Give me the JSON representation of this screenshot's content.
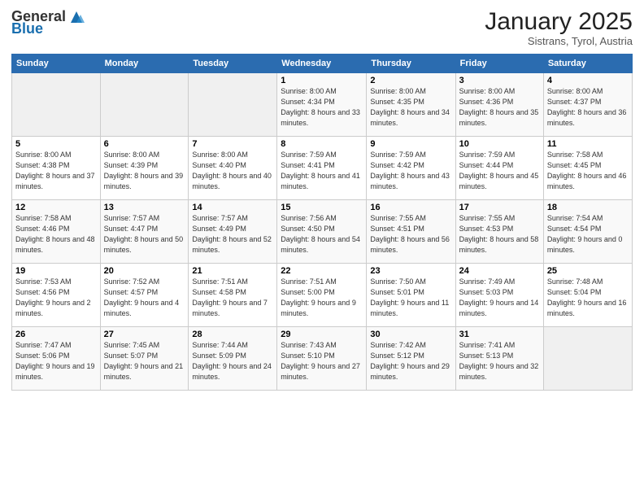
{
  "logo": {
    "general": "General",
    "blue": "Blue"
  },
  "header": {
    "month": "January 2025",
    "location": "Sistrans, Tyrol, Austria"
  },
  "days_of_week": [
    "Sunday",
    "Monday",
    "Tuesday",
    "Wednesday",
    "Thursday",
    "Friday",
    "Saturday"
  ],
  "weeks": [
    [
      {
        "day": "",
        "sunrise": "",
        "sunset": "",
        "daylight": ""
      },
      {
        "day": "",
        "sunrise": "",
        "sunset": "",
        "daylight": ""
      },
      {
        "day": "",
        "sunrise": "",
        "sunset": "",
        "daylight": ""
      },
      {
        "day": "1",
        "sunrise": "Sunrise: 8:00 AM",
        "sunset": "Sunset: 4:34 PM",
        "daylight": "Daylight: 8 hours and 33 minutes."
      },
      {
        "day": "2",
        "sunrise": "Sunrise: 8:00 AM",
        "sunset": "Sunset: 4:35 PM",
        "daylight": "Daylight: 8 hours and 34 minutes."
      },
      {
        "day": "3",
        "sunrise": "Sunrise: 8:00 AM",
        "sunset": "Sunset: 4:36 PM",
        "daylight": "Daylight: 8 hours and 35 minutes."
      },
      {
        "day": "4",
        "sunrise": "Sunrise: 8:00 AM",
        "sunset": "Sunset: 4:37 PM",
        "daylight": "Daylight: 8 hours and 36 minutes."
      }
    ],
    [
      {
        "day": "5",
        "sunrise": "Sunrise: 8:00 AM",
        "sunset": "Sunset: 4:38 PM",
        "daylight": "Daylight: 8 hours and 37 minutes."
      },
      {
        "day": "6",
        "sunrise": "Sunrise: 8:00 AM",
        "sunset": "Sunset: 4:39 PM",
        "daylight": "Daylight: 8 hours and 39 minutes."
      },
      {
        "day": "7",
        "sunrise": "Sunrise: 8:00 AM",
        "sunset": "Sunset: 4:40 PM",
        "daylight": "Daylight: 8 hours and 40 minutes."
      },
      {
        "day": "8",
        "sunrise": "Sunrise: 7:59 AM",
        "sunset": "Sunset: 4:41 PM",
        "daylight": "Daylight: 8 hours and 41 minutes."
      },
      {
        "day": "9",
        "sunrise": "Sunrise: 7:59 AM",
        "sunset": "Sunset: 4:42 PM",
        "daylight": "Daylight: 8 hours and 43 minutes."
      },
      {
        "day": "10",
        "sunrise": "Sunrise: 7:59 AM",
        "sunset": "Sunset: 4:44 PM",
        "daylight": "Daylight: 8 hours and 45 minutes."
      },
      {
        "day": "11",
        "sunrise": "Sunrise: 7:58 AM",
        "sunset": "Sunset: 4:45 PM",
        "daylight": "Daylight: 8 hours and 46 minutes."
      }
    ],
    [
      {
        "day": "12",
        "sunrise": "Sunrise: 7:58 AM",
        "sunset": "Sunset: 4:46 PM",
        "daylight": "Daylight: 8 hours and 48 minutes."
      },
      {
        "day": "13",
        "sunrise": "Sunrise: 7:57 AM",
        "sunset": "Sunset: 4:47 PM",
        "daylight": "Daylight: 8 hours and 50 minutes."
      },
      {
        "day": "14",
        "sunrise": "Sunrise: 7:57 AM",
        "sunset": "Sunset: 4:49 PM",
        "daylight": "Daylight: 8 hours and 52 minutes."
      },
      {
        "day": "15",
        "sunrise": "Sunrise: 7:56 AM",
        "sunset": "Sunset: 4:50 PM",
        "daylight": "Daylight: 8 hours and 54 minutes."
      },
      {
        "day": "16",
        "sunrise": "Sunrise: 7:55 AM",
        "sunset": "Sunset: 4:51 PM",
        "daylight": "Daylight: 8 hours and 56 minutes."
      },
      {
        "day": "17",
        "sunrise": "Sunrise: 7:55 AM",
        "sunset": "Sunset: 4:53 PM",
        "daylight": "Daylight: 8 hours and 58 minutes."
      },
      {
        "day": "18",
        "sunrise": "Sunrise: 7:54 AM",
        "sunset": "Sunset: 4:54 PM",
        "daylight": "Daylight: 9 hours and 0 minutes."
      }
    ],
    [
      {
        "day": "19",
        "sunrise": "Sunrise: 7:53 AM",
        "sunset": "Sunset: 4:56 PM",
        "daylight": "Daylight: 9 hours and 2 minutes."
      },
      {
        "day": "20",
        "sunrise": "Sunrise: 7:52 AM",
        "sunset": "Sunset: 4:57 PM",
        "daylight": "Daylight: 9 hours and 4 minutes."
      },
      {
        "day": "21",
        "sunrise": "Sunrise: 7:51 AM",
        "sunset": "Sunset: 4:58 PM",
        "daylight": "Daylight: 9 hours and 7 minutes."
      },
      {
        "day": "22",
        "sunrise": "Sunrise: 7:51 AM",
        "sunset": "Sunset: 5:00 PM",
        "daylight": "Daylight: 9 hours and 9 minutes."
      },
      {
        "day": "23",
        "sunrise": "Sunrise: 7:50 AM",
        "sunset": "Sunset: 5:01 PM",
        "daylight": "Daylight: 9 hours and 11 minutes."
      },
      {
        "day": "24",
        "sunrise": "Sunrise: 7:49 AM",
        "sunset": "Sunset: 5:03 PM",
        "daylight": "Daylight: 9 hours and 14 minutes."
      },
      {
        "day": "25",
        "sunrise": "Sunrise: 7:48 AM",
        "sunset": "Sunset: 5:04 PM",
        "daylight": "Daylight: 9 hours and 16 minutes."
      }
    ],
    [
      {
        "day": "26",
        "sunrise": "Sunrise: 7:47 AM",
        "sunset": "Sunset: 5:06 PM",
        "daylight": "Daylight: 9 hours and 19 minutes."
      },
      {
        "day": "27",
        "sunrise": "Sunrise: 7:45 AM",
        "sunset": "Sunset: 5:07 PM",
        "daylight": "Daylight: 9 hours and 21 minutes."
      },
      {
        "day": "28",
        "sunrise": "Sunrise: 7:44 AM",
        "sunset": "Sunset: 5:09 PM",
        "daylight": "Daylight: 9 hours and 24 minutes."
      },
      {
        "day": "29",
        "sunrise": "Sunrise: 7:43 AM",
        "sunset": "Sunset: 5:10 PM",
        "daylight": "Daylight: 9 hours and 27 minutes."
      },
      {
        "day": "30",
        "sunrise": "Sunrise: 7:42 AM",
        "sunset": "Sunset: 5:12 PM",
        "daylight": "Daylight: 9 hours and 29 minutes."
      },
      {
        "day": "31",
        "sunrise": "Sunrise: 7:41 AM",
        "sunset": "Sunset: 5:13 PM",
        "daylight": "Daylight: 9 hours and 32 minutes."
      },
      {
        "day": "",
        "sunrise": "",
        "sunset": "",
        "daylight": ""
      }
    ]
  ]
}
